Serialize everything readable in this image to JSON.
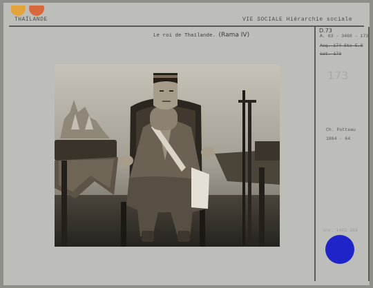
{
  "header": {
    "country": "THAÏLANDE",
    "section": "VIE SOCIALE   Hiérarchie sociale"
  },
  "caption": {
    "text": "Le roi de Thaïlande.",
    "handwritten": "(Rama IV)"
  },
  "side_notes": {
    "ref_main": "A. 63 - 3468 - 173",
    "ref_prefix": "D.73",
    "struck_line_1": "Acq. 174 Ste 5.8",
    "struck_line_2": "cat. 173",
    "faded_number": "173",
    "author": "Ch. Potteau",
    "dates": "1864 - 64",
    "inventory": "inv. 1492-163"
  },
  "colors": {
    "dot1": "#e2a33a",
    "dot2": "#d8673c",
    "sticker": "#1f24c8"
  }
}
